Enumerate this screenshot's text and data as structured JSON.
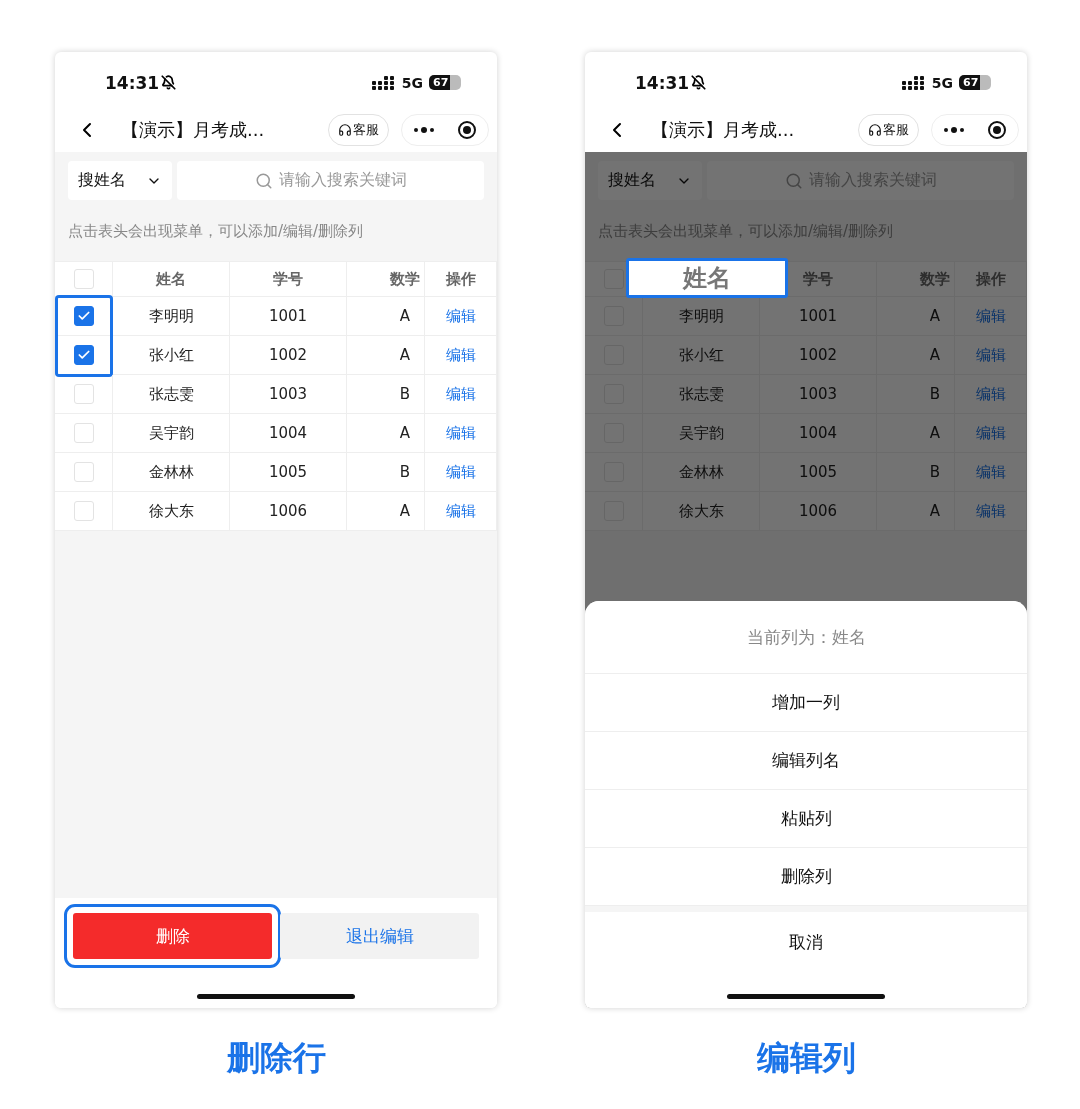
{
  "screens": [
    {
      "status_bar": {
        "time": "14:31",
        "network": "5G",
        "battery": "67"
      },
      "nav": {
        "title": "【演示】月考成...",
        "service_label": "客服"
      },
      "search": {
        "filter": "搜姓名",
        "placeholder": "请输入搜索关键词"
      },
      "hint": "点击表头会出现菜单，可以添加/编辑/删除列",
      "dimmed": false,
      "table": {
        "header_checked": false,
        "columns": [
          {
            "label": "姓名",
            "selected": false
          },
          {
            "label": "学号",
            "selected": false
          },
          {
            "label": "数学",
            "selected": false
          },
          {
            "label": "操作",
            "selected": false
          }
        ],
        "rows": [
          {
            "name": "李明明",
            "id": "1001",
            "math": "A",
            "action": "编辑",
            "checked": true,
            "highlighted": true
          },
          {
            "name": "张小红",
            "id": "1002",
            "math": "A",
            "action": "编辑",
            "checked": true,
            "highlighted": true
          },
          {
            "name": "张志雯",
            "id": "1003",
            "math": "B",
            "action": "编辑",
            "checked": false,
            "highlighted": false
          },
          {
            "name": "吴宇韵",
            "id": "1004",
            "math": "A",
            "action": "编辑",
            "checked": false,
            "highlighted": false
          },
          {
            "name": "金林林",
            "id": "1005",
            "math": "B",
            "action": "编辑",
            "checked": false,
            "highlighted": false
          },
          {
            "name": "徐大东",
            "id": "1006",
            "math": "A",
            "action": "编辑",
            "checked": false,
            "highlighted": false
          }
        ]
      },
      "bottom_bar": {
        "buttons": [
          {
            "label": "删除",
            "kind": "danger",
            "highlighted": true
          },
          {
            "label": "退出编辑",
            "kind": "plain",
            "highlighted": false
          }
        ]
      },
      "caption": "删除行"
    },
    {
      "status_bar": {
        "time": "14:31",
        "network": "5G",
        "battery": "67"
      },
      "nav": {
        "title": "【演示】月考成...",
        "service_label": "客服"
      },
      "search": {
        "filter": "搜姓名",
        "placeholder": "请输入搜索关键词"
      },
      "hint": "点击表头会出现菜单，可以添加/编辑/删除列",
      "dimmed": true,
      "table": {
        "header_checked": false,
        "columns": [
          {
            "label": "姓名",
            "selected": true
          },
          {
            "label": "学号",
            "selected": false
          },
          {
            "label": "数学",
            "selected": false
          },
          {
            "label": "操作",
            "selected": false
          }
        ],
        "rows": [
          {
            "name": "李明明",
            "id": "1001",
            "math": "A",
            "action": "编辑",
            "checked": false,
            "highlighted": false
          },
          {
            "name": "张小红",
            "id": "1002",
            "math": "A",
            "action": "编辑",
            "checked": false,
            "highlighted": false
          },
          {
            "name": "张志雯",
            "id": "1003",
            "math": "B",
            "action": "编辑",
            "checked": false,
            "highlighted": false
          },
          {
            "name": "吴宇韵",
            "id": "1004",
            "math": "A",
            "action": "编辑",
            "checked": false,
            "highlighted": false
          },
          {
            "name": "金林林",
            "id": "1005",
            "math": "B",
            "action": "编辑",
            "checked": false,
            "highlighted": false
          },
          {
            "name": "徐大东",
            "id": "1006",
            "math": "A",
            "action": "编辑",
            "checked": false,
            "highlighted": false
          }
        ]
      },
      "action_sheet": {
        "title": "当前列为：姓名",
        "items": [
          "增加一列",
          "编辑列名",
          "粘贴列",
          "删除列"
        ],
        "cancel": "取消"
      },
      "caption": "编辑列"
    }
  ]
}
